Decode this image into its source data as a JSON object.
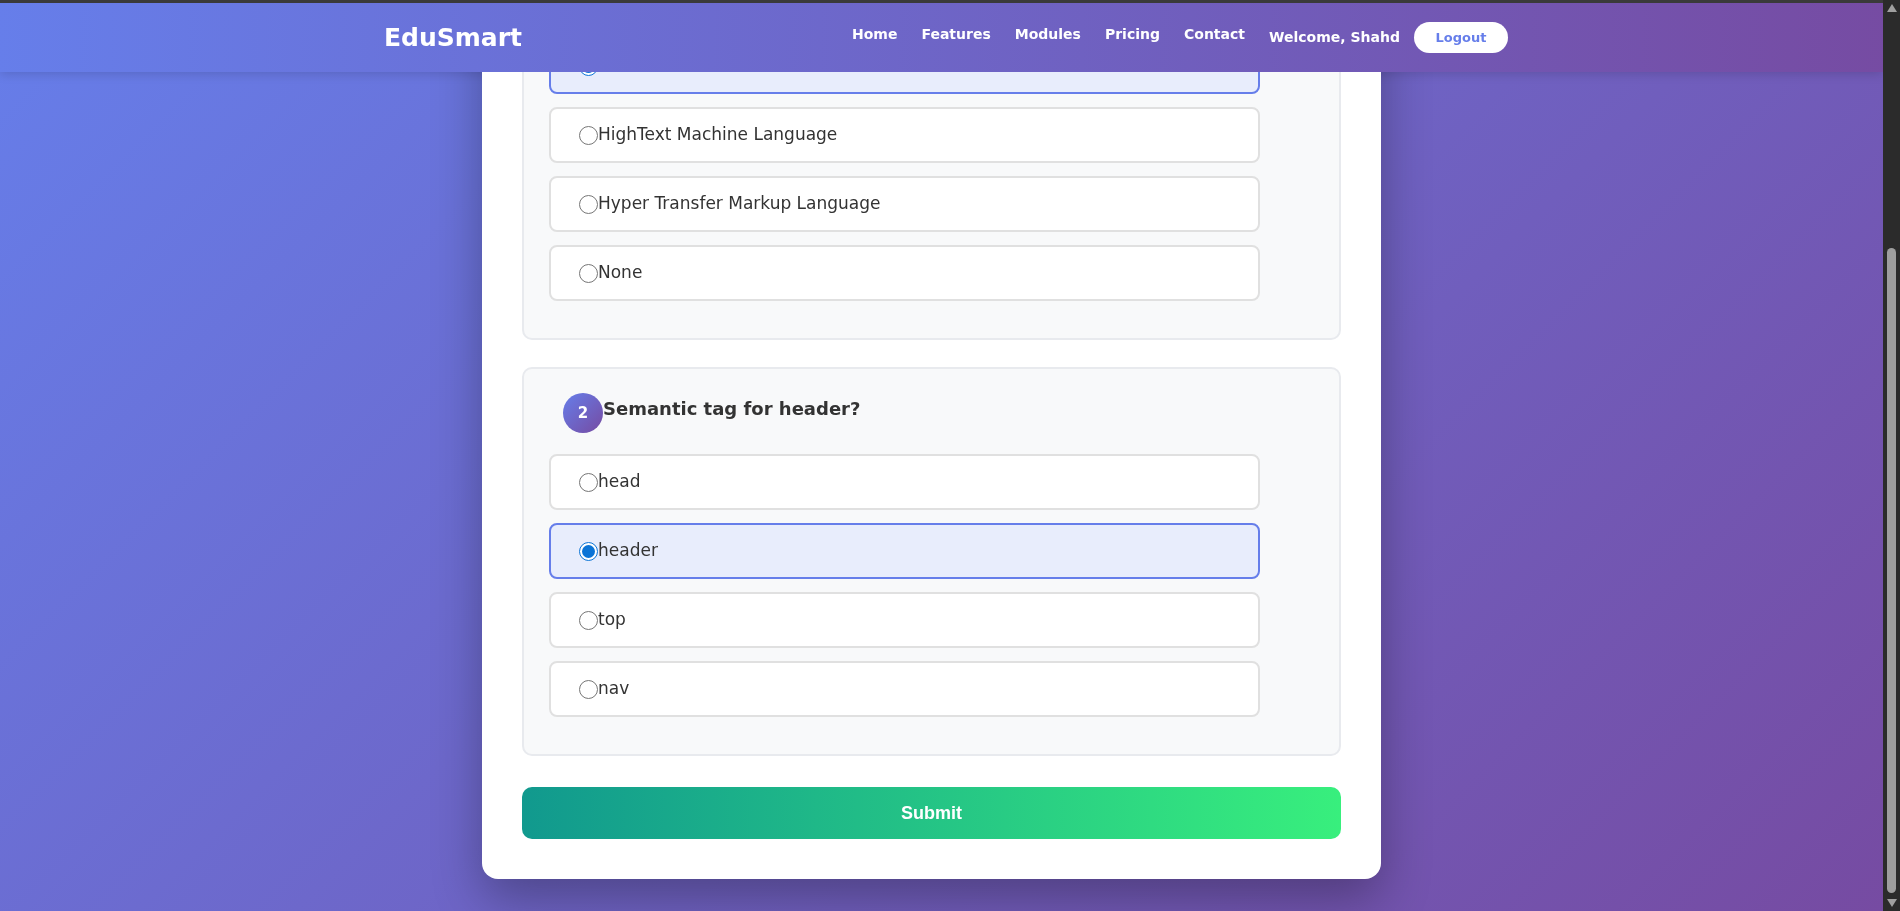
{
  "navbar": {
    "logo": "EduSmart",
    "links": [
      "Home",
      "Features",
      "Modules",
      "Pricing",
      "Contact"
    ],
    "welcome": "Welcome, Shahd",
    "logout": "Logout"
  },
  "questions": [
    {
      "options": [
        {
          "selected": true
        },
        {
          "label": "HighText Machine Language",
          "selected": false
        },
        {
          "label": "Hyper Transfer Markup Language",
          "selected": false
        },
        {
          "label": "None",
          "selected": false
        }
      ]
    },
    {
      "number": "2",
      "text": "Semantic tag for header?",
      "options": [
        {
          "label": "head",
          "selected": false
        },
        {
          "label": "header",
          "selected": true
        },
        {
          "label": "top",
          "selected": false
        },
        {
          "label": "nav",
          "selected": false
        }
      ]
    }
  ],
  "submit": "Submit"
}
